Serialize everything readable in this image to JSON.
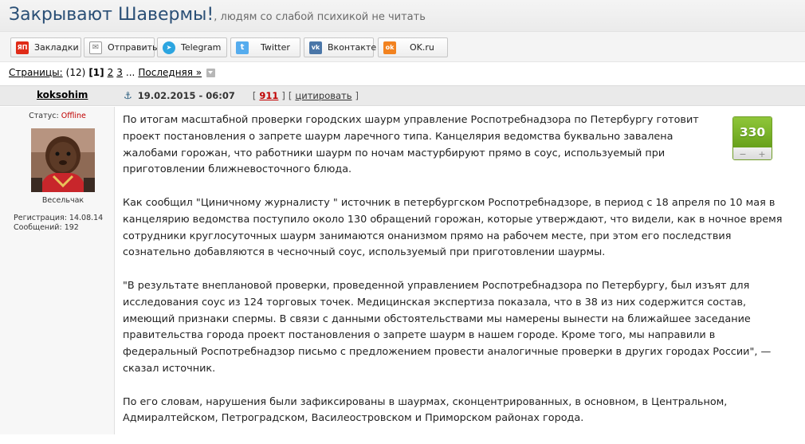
{
  "title": {
    "main": "Закрывают Шавермы!",
    "sub": ", людям со слабой психикой не читать"
  },
  "share": [
    {
      "label": "Закладки",
      "icon": "yandex-icon",
      "icon_text": "ЯП",
      "color": "#e02b18"
    },
    {
      "label": "Отправить",
      "icon": "mail-icon",
      "icon_text": "✉",
      "color": "#ffffff"
    },
    {
      "label": "Telegram",
      "icon": "telegram-icon",
      "icon_text": "➤",
      "color": "#2ca5e0"
    },
    {
      "label": "Twitter",
      "icon": "twitter-icon",
      "icon_text": "t",
      "color": "#55acee"
    },
    {
      "label": "Вконтакте",
      "icon": "vk-icon",
      "icon_text": "vk",
      "color": "#4a76a8"
    },
    {
      "label": "OK.ru",
      "icon": "ok-icon",
      "icon_text": "ok",
      "color": "#f2821f"
    }
  ],
  "pager": {
    "label": "Страницы:",
    "count": "(12)",
    "current": "[1]",
    "p2": "2",
    "p3": "3",
    "ellipsis": "...",
    "last": "Последняя »"
  },
  "post": {
    "username": "koksohim",
    "date": "19.02.2015 - 06:07",
    "number": "911",
    "quote": "цитировать",
    "open_bracket": "[",
    "close_bracket": "]"
  },
  "user": {
    "status_label": "Статус:",
    "status_value": "Offline",
    "rank": "Весельчак",
    "registration": "Регистрация: 14.08.14",
    "messages": "Сообщений: 192"
  },
  "rating": {
    "score": "330",
    "minus": "−",
    "plus": "+"
  },
  "body": [
    "По итогам масштабной проверки городских шаурм управление Роспотребнадзора по Петербургу готовит проект постановления о запрете шаурм ларечного типа. Канцелярия ведомства буквально завалена жалобами горожан, что работники шаурм по ночам мастурбируют прямо в соус, используемый при приготовлении ближневосточного блюда.",
    "Как сообщил \"Циничному журналисту \" источник в петербургском Роспотребнадзоре, в период с 18 апреля по 10 мая в канцелярию ведомства поступило около 130 обращений горожан, которые утверждают, что видели, как в ночное время сотрудники круглосуточных шаурм занимаются онанизмом прямо на рабочем месте, при этом его последствия сознательно добавляются в чесночный соус, используемый при приготовлении шаурмы.",
    "\"В результате внеплановой проверки, проведенной управлением Роспотребнадзора по Петербургу, был изъят для исследования соус из 124 торговых точек. Медицинская экспертиза показала, что в 38 из них содержится состав, имеющий признаки спермы. В связи с данными обстоятельствами мы намерены вынести на ближайшее заседание правительства города проект постановления о запрете шаурм в нашем городе. Кроме того, мы направили в федеральный Роспотребнадзор письмо с предложением провести аналогичные проверки в других городах России\", — сказал источник.",
    "По его словам, нарушения были зафиксированы в шаурмах, сконцентрированных, в основном, в Центральном, Адмиралтейском, Петроградском, Василеостровском и Приморском районах города."
  ]
}
